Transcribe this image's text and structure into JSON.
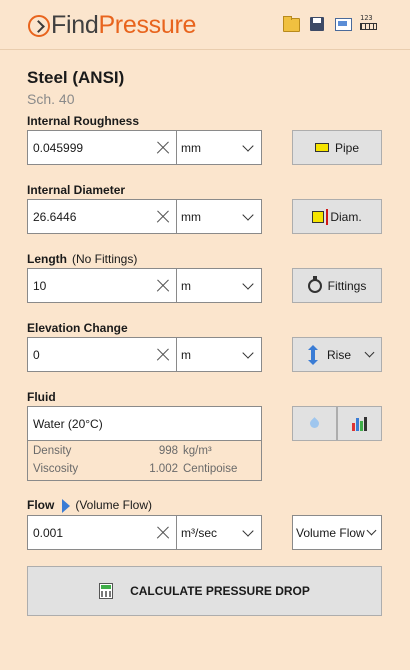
{
  "app": {
    "logo_find": "Find",
    "logo_pressure": "Pressure"
  },
  "toolbar": {
    "icons": [
      "folder-icon",
      "save-icon",
      "report-icon",
      "units-icon"
    ],
    "units_label": "123"
  },
  "material": {
    "name": "Steel (ANSI)",
    "schedule": "Sch.  40"
  },
  "roughness": {
    "label": "Internal Roughness",
    "value": "0.045999",
    "unit": "mm",
    "button": "Pipe"
  },
  "diameter": {
    "label": "Internal Diameter",
    "value": "26.6446",
    "unit": "mm",
    "button": "Diam."
  },
  "length": {
    "label": "Length",
    "sublabel": "(No Fittings)",
    "value": "10",
    "unit": "m",
    "button": "Fittings"
  },
  "elevation": {
    "label": "Elevation Change",
    "value": "0",
    "unit": "m",
    "button": "Rise"
  },
  "fluid": {
    "label": "Fluid",
    "value": "Water (20°C)",
    "density": {
      "name": "Density",
      "value": "998",
      "unit": "kg/m³"
    },
    "viscosity": {
      "name": "Viscosity",
      "value": "1.002",
      "unit": "Centipoise"
    }
  },
  "flow": {
    "label": "Flow",
    "sublabel": "(Volume Flow)",
    "value": "0.001",
    "unit": "m³/sec",
    "type": "Volume Flow"
  },
  "calculate": {
    "label": "CALCULATE PRESSURE DROP"
  },
  "colors": {
    "background": "#fbe5cd",
    "accent": "#e8641d",
    "arrow": "#3a7cd5"
  }
}
